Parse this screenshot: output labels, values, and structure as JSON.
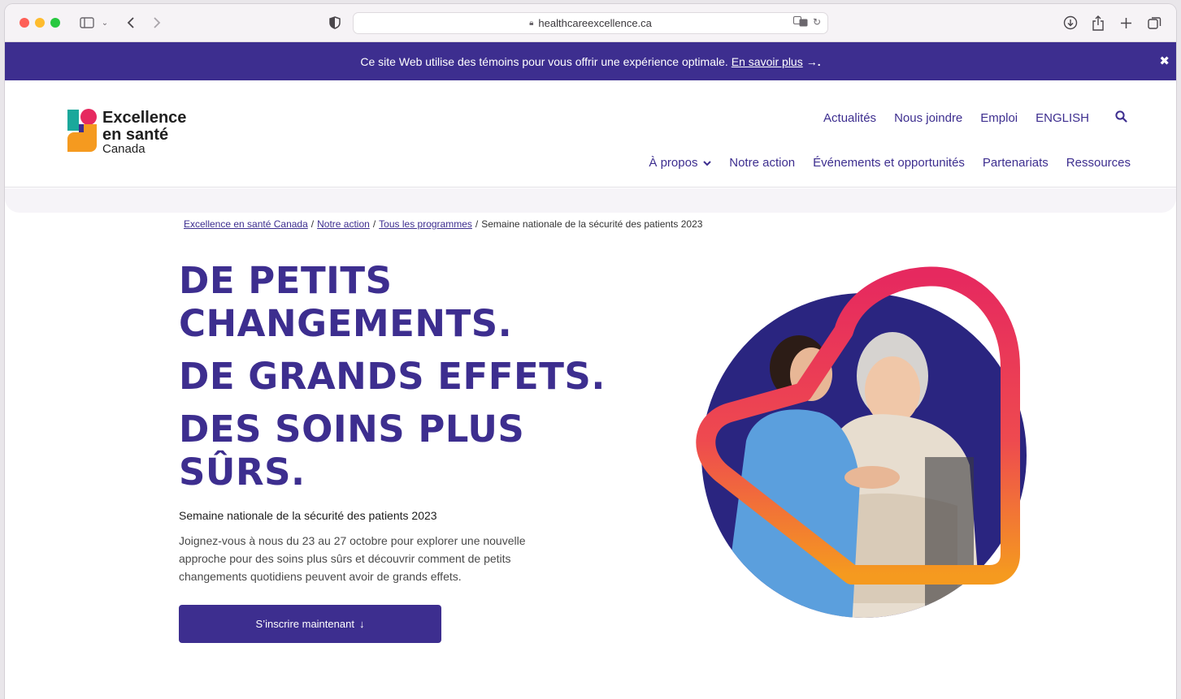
{
  "browser": {
    "url": "healthcareexcellence.ca"
  },
  "cookie_banner": {
    "text": "Ce site Web utilise des témoins pour vous offrir une expérience optimale.",
    "link": "En savoir plus",
    "arrow": "→.",
    "close": "✖"
  },
  "logo": {
    "line1": "Excellence",
    "line2": "en santé",
    "line3": "Canada"
  },
  "util_nav": [
    "Actualités",
    "Nous joindre",
    "Emploi",
    "ENGLISH"
  ],
  "main_nav": {
    "about": "À propos",
    "action": "Notre action",
    "events": "Événements et opportunités",
    "partners": "Partenariats",
    "resources": "Ressources"
  },
  "breadcrumb": {
    "home": "Excellence en santé Canada",
    "action": "Notre action",
    "programs": "Tous les programmes",
    "current": "Semaine nationale de la sécurité des patients 2023",
    "sep": "/"
  },
  "hero": {
    "line1": "DE PETITS",
    "line2": "CHANGEMENTS.",
    "line3": "DE GRANDS EFFETS.",
    "line4": "DES SOINS PLUS",
    "line5": "SÛRS.",
    "subheading": "Semaine nationale de la sécurité des patients 2023",
    "description": "Joignez-vous à nous du 23 au 27 octobre pour explorer une nouvelle approche pour des soins plus sûrs et découvrir comment de petits changements quotidiens peuvent avoir de grands effets.",
    "cta": "S’inscrire maintenant",
    "cta_arrow": "↓"
  },
  "colors": {
    "brand_purple": "#3d2e8f",
    "heart_pink": "#e6295f",
    "heart_orange": "#f59a1f"
  }
}
